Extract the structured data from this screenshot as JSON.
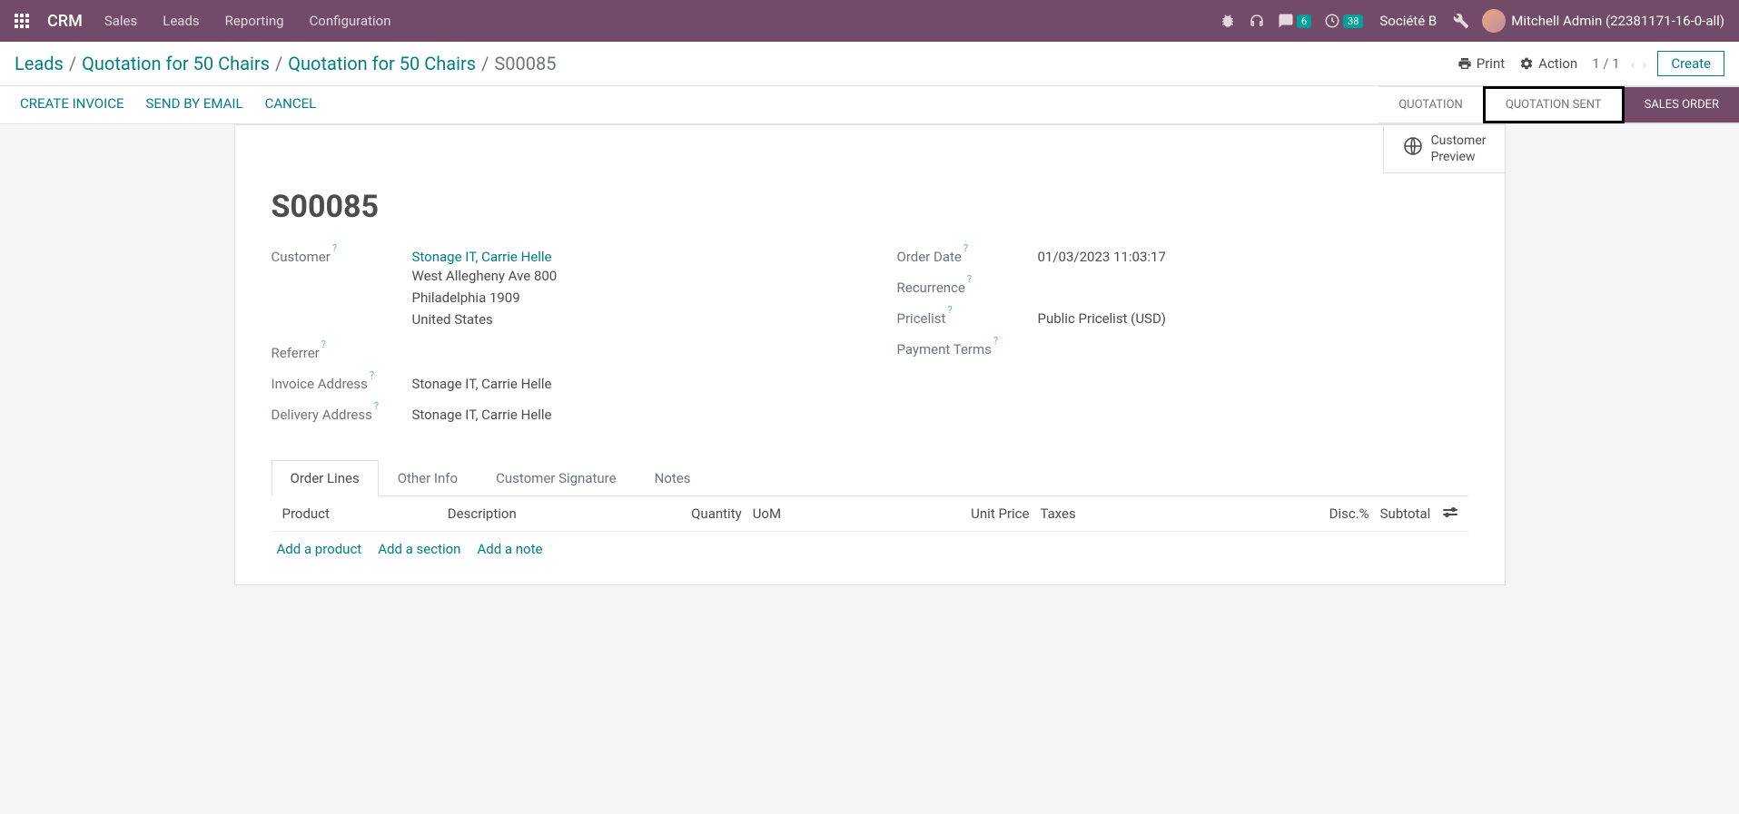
{
  "navbar": {
    "brand": "CRM",
    "menu": [
      "Sales",
      "Leads",
      "Reporting",
      "Configuration"
    ],
    "messages_badge": "6",
    "activities_badge": "38",
    "company": "Société B",
    "user": "Mitchell Admin (22381171-16-0-all)"
  },
  "breadcrumb": {
    "items": [
      "Leads",
      "Quotation for 50 Chairs",
      "Quotation for 50 Chairs"
    ],
    "current": "S00085"
  },
  "controls": {
    "print": "Print",
    "action": "Action",
    "pager": "1 / 1",
    "create": "Create"
  },
  "actions": {
    "create_invoice": "CREATE INVOICE",
    "send_email": "SEND BY EMAIL",
    "cancel": "CANCEL"
  },
  "status": {
    "quotation": "QUOTATION",
    "quotation_sent": "QUOTATION SENT",
    "sales_order": "SALES ORDER"
  },
  "stat_button": {
    "line1": "Customer",
    "line2": "Preview"
  },
  "form": {
    "title": "S00085",
    "left": {
      "customer_label": "Customer",
      "customer_link": "Stonage IT, Carrie Helle",
      "customer_addr1": "West Allegheny Ave 800",
      "customer_addr2": "Philadelphia 1909",
      "customer_addr3": "United States",
      "referrer_label": "Referrer",
      "invoice_addr_label": "Invoice Address",
      "invoice_addr_value": "Stonage IT, Carrie Helle",
      "delivery_addr_label": "Delivery Address",
      "delivery_addr_value": "Stonage IT, Carrie Helle"
    },
    "right": {
      "order_date_label": "Order Date",
      "order_date_value": "01/03/2023 11:03:17",
      "recurrence_label": "Recurrence",
      "pricelist_label": "Pricelist",
      "pricelist_value": "Public Pricelist (USD)",
      "payment_terms_label": "Payment Terms"
    }
  },
  "tabs": {
    "order_lines": "Order Lines",
    "other_info": "Other Info",
    "customer_signature": "Customer Signature",
    "notes": "Notes"
  },
  "table": {
    "product": "Product",
    "description": "Description",
    "quantity": "Quantity",
    "uom": "UoM",
    "unit_price": "Unit Price",
    "taxes": "Taxes",
    "disc": "Disc.%",
    "subtotal": "Subtotal"
  },
  "add_links": {
    "product": "Add a product",
    "section": "Add a section",
    "note": "Add a note"
  }
}
